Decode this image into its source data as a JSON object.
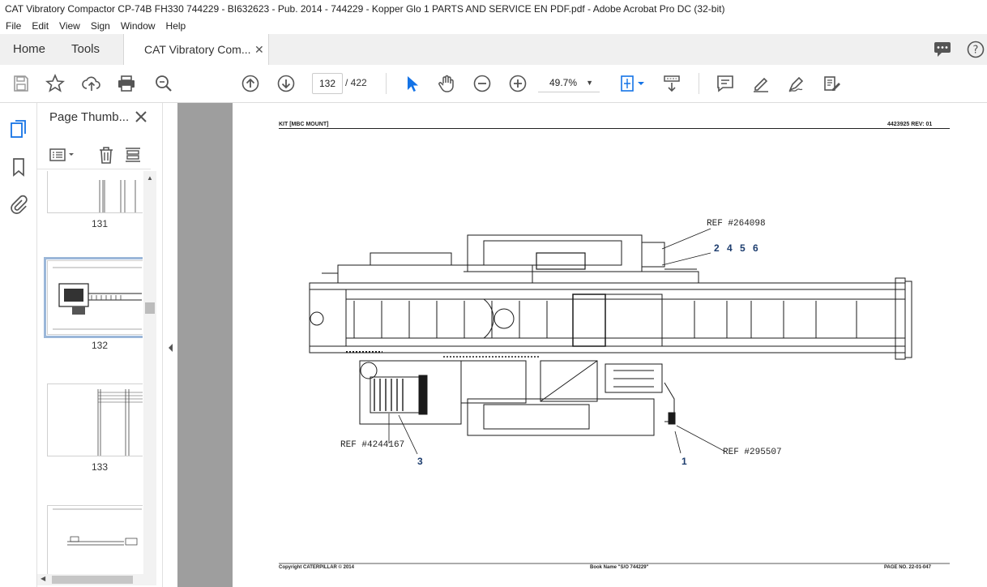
{
  "window": {
    "title": "CAT Vibratory Compactor CP-74B FH330 744229 - BI632623 - Pub. 2014 - 744229 - Kopper Glo 1 PARTS AND SERVICE EN PDF.pdf - Adobe Acrobat Pro DC (32-bit)"
  },
  "menu": [
    "File",
    "Edit",
    "View",
    "Sign",
    "Window",
    "Help"
  ],
  "tabs": {
    "home": "Home",
    "tools": "Tools",
    "doc": "CAT Vibratory Com..."
  },
  "toolbar": {
    "page_current": "132",
    "page_total": "/ 422",
    "zoom": "49.7%"
  },
  "thumbnails": {
    "title": "Page Thumb...",
    "pages": [
      {
        "label": "131"
      },
      {
        "label": "132",
        "selected": true
      },
      {
        "label": "133"
      }
    ]
  },
  "document": {
    "header_left": "KIT [MBC MOUNT]",
    "header_right": "4423925    REV:  01",
    "callouts": {
      "ref1": "REF #264098",
      "ref2": "REF #4244167",
      "ref3": "REF #295507"
    },
    "item_numbers": {
      "group": "2  4  5  6",
      "n3": "3",
      "n1": "1"
    },
    "footer_left": "Copyright CATERPILLAR © 2014",
    "footer_mid": "Book Name \"S/O 744229\"",
    "footer_right": "PAGE NO.    22-01-047"
  },
  "colors": {
    "accent": "#1473e6",
    "canvas": "#9e9e9e",
    "callout_number": "#1d3d6e"
  }
}
